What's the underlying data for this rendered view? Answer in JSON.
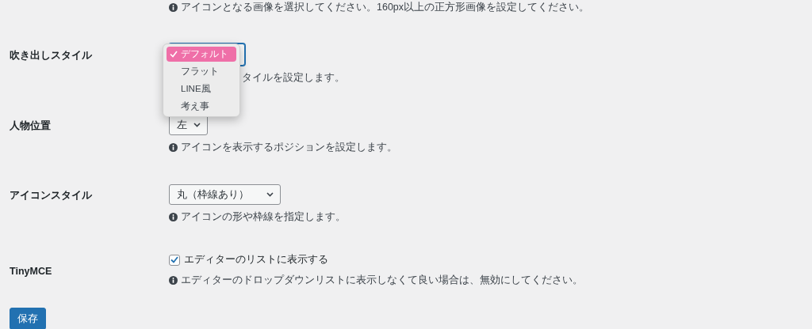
{
  "top_hint": "アイコンとなる画像を選択してください。160px以上の正方形画像を設定してください。",
  "rows": [
    {
      "kind": "dropdown",
      "label": "吹き出しスタイル",
      "focused": true,
      "options": [
        {
          "label": "デフォルト",
          "selected": true
        },
        {
          "label": "フラット",
          "selected": false
        },
        {
          "label": "LINE風",
          "selected": false
        },
        {
          "label": "考え事",
          "selected": false
        }
      ],
      "hint": "タイルを設定します。"
    },
    {
      "kind": "select",
      "label": "人物位置",
      "value": "左",
      "hint": "アイコンを表示するポジションを設定します。"
    },
    {
      "kind": "select",
      "label": "アイコンスタイル",
      "value": "丸（枠線あり）",
      "hint": "アイコンの形や枠線を指定します。"
    },
    {
      "kind": "checkbox",
      "label": "TinyMCE",
      "checked": true,
      "text": "エディターのリストに表示する",
      "hint": "エディターのドロップダウンリストに表示しなくて良い場合は、無効にしてください。"
    }
  ],
  "save_button": "保存"
}
